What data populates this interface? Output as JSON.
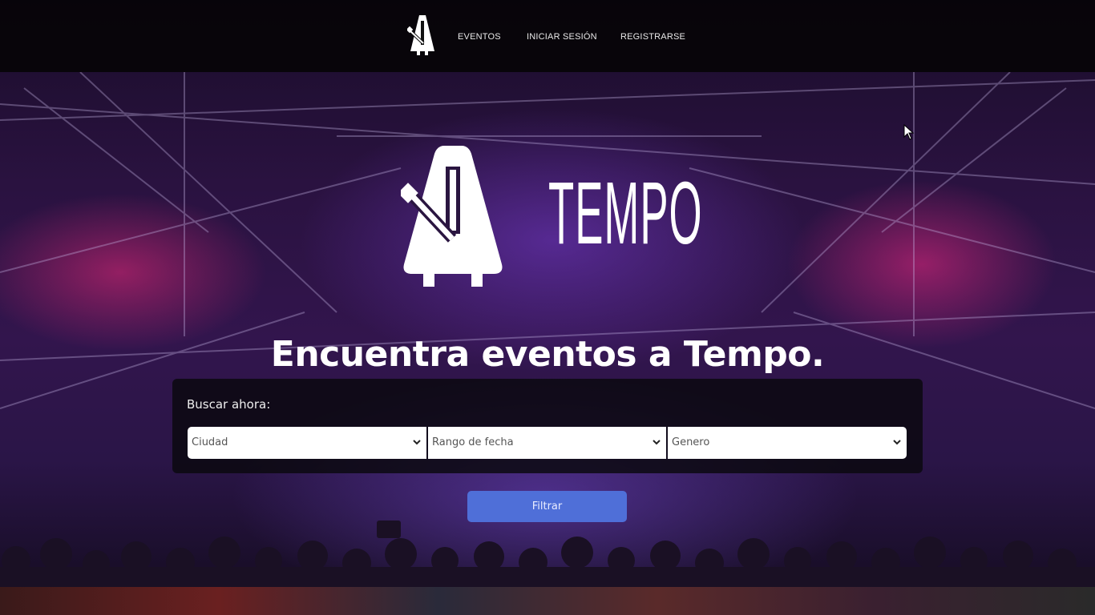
{
  "nav": {
    "logo_icon": "metronome-icon",
    "links": [
      "EVENTOS",
      "INICIAR SESIÓN",
      "REGISTRARSE"
    ]
  },
  "brand": {
    "logo_icon": "metronome-icon",
    "name": "TEMPO"
  },
  "hero": {
    "headline": "Encuentra eventos a Tempo."
  },
  "search": {
    "title": "Buscar ahora:",
    "city_select": "Ciudad",
    "date_select": "Rango de fecha",
    "genre_select": "Genero",
    "dropdown_icon": "chevron-down-icon",
    "button_label": "Filtrar"
  },
  "colors": {
    "button": "#4f6fd8",
    "navbar": "#060408",
    "panel": "#0a080e"
  }
}
